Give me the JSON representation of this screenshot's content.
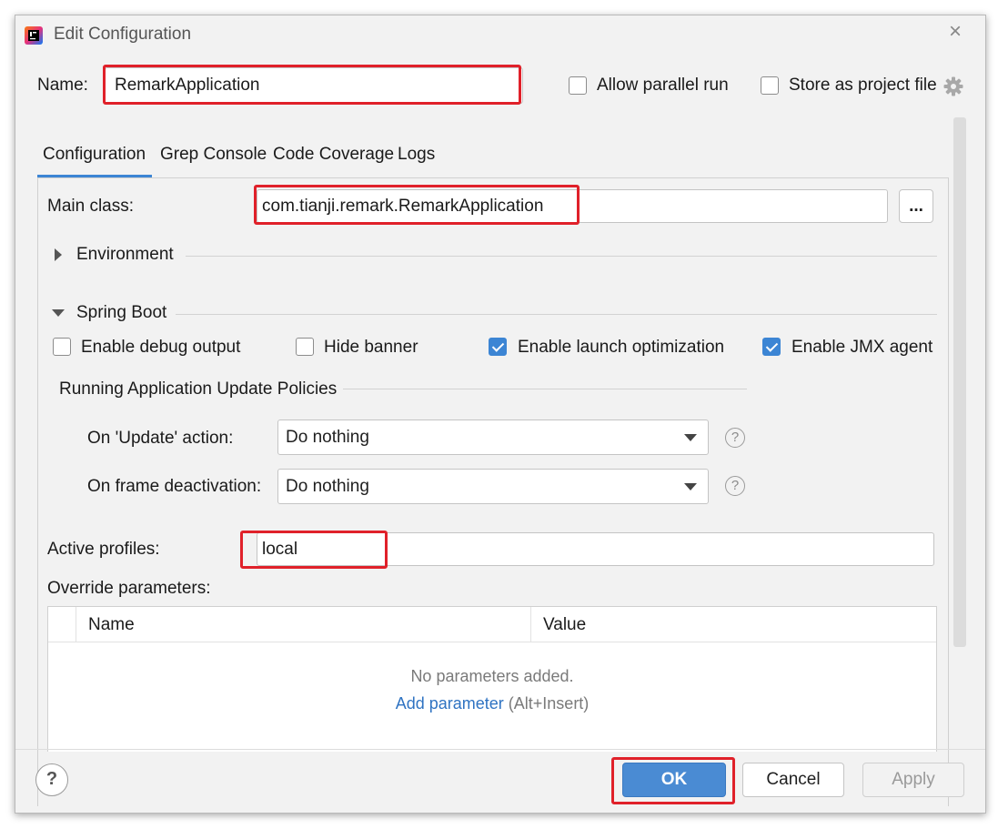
{
  "window": {
    "title": "Edit Configuration",
    "close_glyph": "×"
  },
  "name_row": {
    "label": "Name:",
    "value": "RemarkApplication"
  },
  "options": {
    "allow_parallel_run": "Allow parallel run",
    "store_as_project_file": "Store as project file"
  },
  "tabs": [
    {
      "label": "Configuration",
      "active": true
    },
    {
      "label": "Grep Console"
    },
    {
      "label": "Code Coverage"
    },
    {
      "label": "Logs"
    }
  ],
  "main_class": {
    "label": "Main class:",
    "value": "com.tianji.remark.RemarkApplication",
    "browse_label": "..."
  },
  "environment": {
    "label": "Environment"
  },
  "spring_boot": {
    "label": "Spring Boot",
    "enable_debug_output": "Enable debug output",
    "hide_banner": "Hide banner",
    "enable_launch_optimization": "Enable launch optimization",
    "enable_jmx_agent": "Enable JMX agent",
    "checkbox_states": {
      "debug": false,
      "hide_banner": false,
      "launch_opt": true,
      "jmx": true
    }
  },
  "update_policies": {
    "title": "Running Application Update Policies",
    "on_update_label": "On 'Update' action:",
    "on_update_value": "Do nothing",
    "on_frame_label": "On frame deactivation:",
    "on_frame_value": "Do nothing",
    "help_glyph": "?"
  },
  "active_profiles": {
    "label": "Active profiles:",
    "value": "local"
  },
  "override": {
    "label": "Override parameters:",
    "columns": [
      "Name",
      "Value"
    ],
    "empty_text": "No parameters added.",
    "add_link": "Add parameter",
    "add_shortcut": "(Alt+Insert)"
  },
  "footer": {
    "help_glyph": "?",
    "ok": "OK",
    "cancel": "Cancel",
    "apply": "Apply"
  },
  "colors": {
    "accent": "#3c85d4",
    "highlight": "#e0212a",
    "link": "#2f73c2"
  }
}
